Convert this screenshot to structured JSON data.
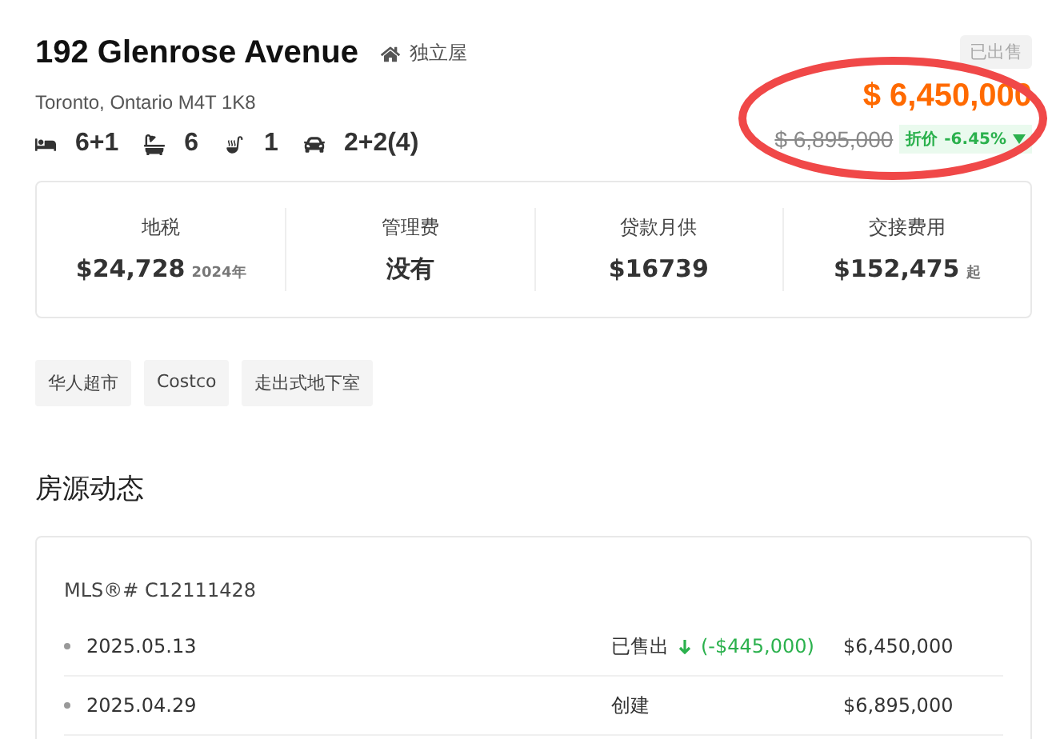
{
  "listing": {
    "address": "192 Glenrose Avenue",
    "type": "独立屋",
    "city": "Toronto, Ontario M4T 1K8",
    "status": "已出售",
    "price": "$ 6,450,000",
    "original_price": "$ 6,895,000",
    "discount_label": "折价",
    "discount": "-6.45%",
    "features": [
      {
        "kind": "bed",
        "value": "6+1"
      },
      {
        "kind": "bath",
        "value": "6"
      },
      {
        "kind": "kitchen",
        "value": "1"
      },
      {
        "kind": "parking",
        "value": "2+2(4)"
      }
    ]
  },
  "stats": [
    {
      "label": "地税",
      "value": "$24,728",
      "suffix": "2024年"
    },
    {
      "label": "管理费",
      "value": "没有"
    },
    {
      "label": "贷款月供",
      "value": "$16739"
    },
    {
      "label": "交接费用",
      "value": "$152,475",
      "suffix": "起"
    }
  ],
  "tags": [
    "华人超市",
    "Costco",
    "走出式地下室"
  ],
  "history": {
    "title": "房源动态",
    "mls": "MLS®# C12111428",
    "events": [
      {
        "date": "2025.05.13",
        "event": "已售出",
        "change": "(-$445,000)",
        "price": "$6,450,000"
      },
      {
        "date": "2025.04.29",
        "event": "创建",
        "price": "$6,895,000"
      }
    ]
  }
}
